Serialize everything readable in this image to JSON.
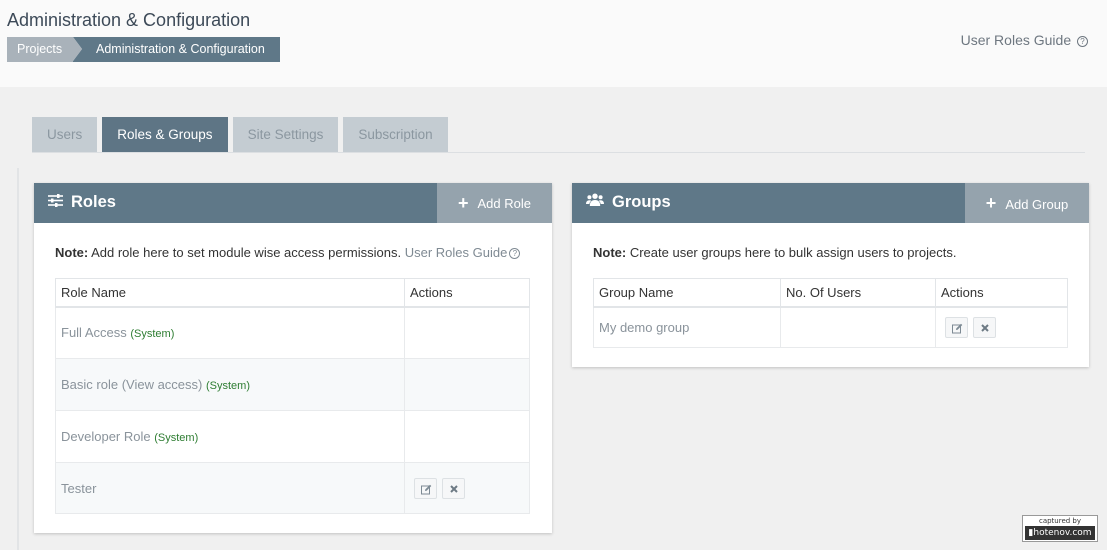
{
  "header": {
    "title": "Administration & Configuration",
    "breadcrumb": [
      "Projects",
      "Administration & Configuration"
    ],
    "guide_link": "User Roles Guide"
  },
  "tabs": [
    {
      "label": "Users",
      "active": false
    },
    {
      "label": "Roles & Groups",
      "active": true
    },
    {
      "label": "Site Settings",
      "active": false
    },
    {
      "label": "Subscription",
      "active": false
    }
  ],
  "roles_panel": {
    "title": "Roles",
    "icon": "sliders-icon",
    "add_button": "Add Role",
    "note_label": "Note:",
    "note_text": " Add role here to set module wise access permissions. ",
    "note_link": "User Roles Guide",
    "columns": [
      "Role Name",
      "Actions"
    ],
    "rows": [
      {
        "name": "Full Access",
        "tag": "(System)",
        "editable": false
      },
      {
        "name": "Basic role (View access)",
        "tag": "(System)",
        "editable": false
      },
      {
        "name": "Developer Role",
        "tag": "(System)",
        "editable": false
      },
      {
        "name": "Tester",
        "tag": "",
        "editable": true
      }
    ]
  },
  "groups_panel": {
    "title": "Groups",
    "icon": "users-icon",
    "add_button": "Add Group",
    "note_label": "Note:",
    "note_text": " Create user groups here to bulk assign users to projects.",
    "columns": [
      "Group Name",
      "No. Of Users",
      "Actions"
    ],
    "rows": [
      {
        "name": "My demo group",
        "users": ""
      }
    ]
  },
  "watermark": {
    "line1": "captured by",
    "line2": "▮hotenov.com"
  },
  "colors": {
    "accent": "#5f7888",
    "tab_active": "#5e7585",
    "system_tag": "#2e7d32"
  }
}
